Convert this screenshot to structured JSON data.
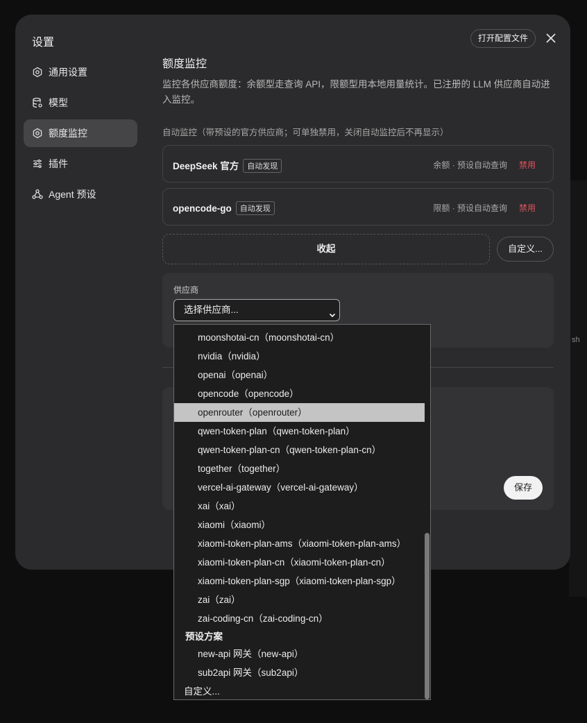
{
  "dialog": {
    "title": "设置",
    "open_config_label": "打开配置文件",
    "close_icon": "close-icon"
  },
  "sidebar": {
    "items": [
      {
        "label": "通用设置",
        "icon": "gear-icon",
        "active": false
      },
      {
        "label": "模型",
        "icon": "database-icon",
        "active": false
      },
      {
        "label": "额度监控",
        "icon": "gear-icon",
        "active": true
      },
      {
        "label": "插件",
        "icon": "sliders-icon",
        "active": false
      },
      {
        "label": "Agent 预设",
        "icon": "agent-icon",
        "active": false
      }
    ]
  },
  "main": {
    "section_title": "额度监控",
    "description": "监控各供应商额度：余额型走查询 API，限额型用本地用量统计。已注册的 LLM 供应商自动进入监控。",
    "auto_label": "自动监控（带预设的官方供应商；可单独禁用，关闭自动监控后不再显示）",
    "providers": [
      {
        "name": "DeepSeek 官方",
        "badge": "自动发现",
        "meta": "余额 · 预设自动查询",
        "action": "禁用"
      },
      {
        "name": "opencode-go",
        "badge": "自动发现",
        "meta": "限额 · 预设自动查询",
        "action": "禁用"
      }
    ],
    "collapse_label": "收起",
    "custom_label": "自定义...",
    "form": {
      "provider_label": "供应商",
      "select_value": "选择供应商..."
    },
    "save_label": "保存"
  },
  "dropdown": {
    "items": [
      {
        "text": "moonshotai-cn（moonshotai-cn）",
        "kind": "opt"
      },
      {
        "text": "nvidia（nvidia）",
        "kind": "opt"
      },
      {
        "text": "openai（openai）",
        "kind": "opt"
      },
      {
        "text": "opencode（opencode）",
        "kind": "opt"
      },
      {
        "text": "openrouter（openrouter）",
        "kind": "opt",
        "selected": true
      },
      {
        "text": "qwen-token-plan（qwen-token-plan）",
        "kind": "opt"
      },
      {
        "text": "qwen-token-plan-cn（qwen-token-plan-cn）",
        "kind": "opt"
      },
      {
        "text": "together（together）",
        "kind": "opt"
      },
      {
        "text": "vercel-ai-gateway（vercel-ai-gateway）",
        "kind": "opt"
      },
      {
        "text": "xai（xai）",
        "kind": "opt"
      },
      {
        "text": "xiaomi（xiaomi）",
        "kind": "opt"
      },
      {
        "text": "xiaomi-token-plan-ams（xiaomi-token-plan-ams）",
        "kind": "opt"
      },
      {
        "text": "xiaomi-token-plan-cn（xiaomi-token-plan-cn）",
        "kind": "opt"
      },
      {
        "text": "xiaomi-token-plan-sgp（xiaomi-token-plan-sgp）",
        "kind": "opt"
      },
      {
        "text": "zai（zai）",
        "kind": "opt"
      },
      {
        "text": "zai-coding-cn（zai-coding-cn）",
        "kind": "opt"
      },
      {
        "text": "预设方案",
        "kind": "grp"
      },
      {
        "text": "new-api 网关（new-api）",
        "kind": "opt"
      },
      {
        "text": "sub2api 网关（sub2api）",
        "kind": "opt"
      },
      {
        "text": "自定义...",
        "kind": "plain"
      }
    ]
  },
  "background": {
    "edge_text": "sh"
  }
}
